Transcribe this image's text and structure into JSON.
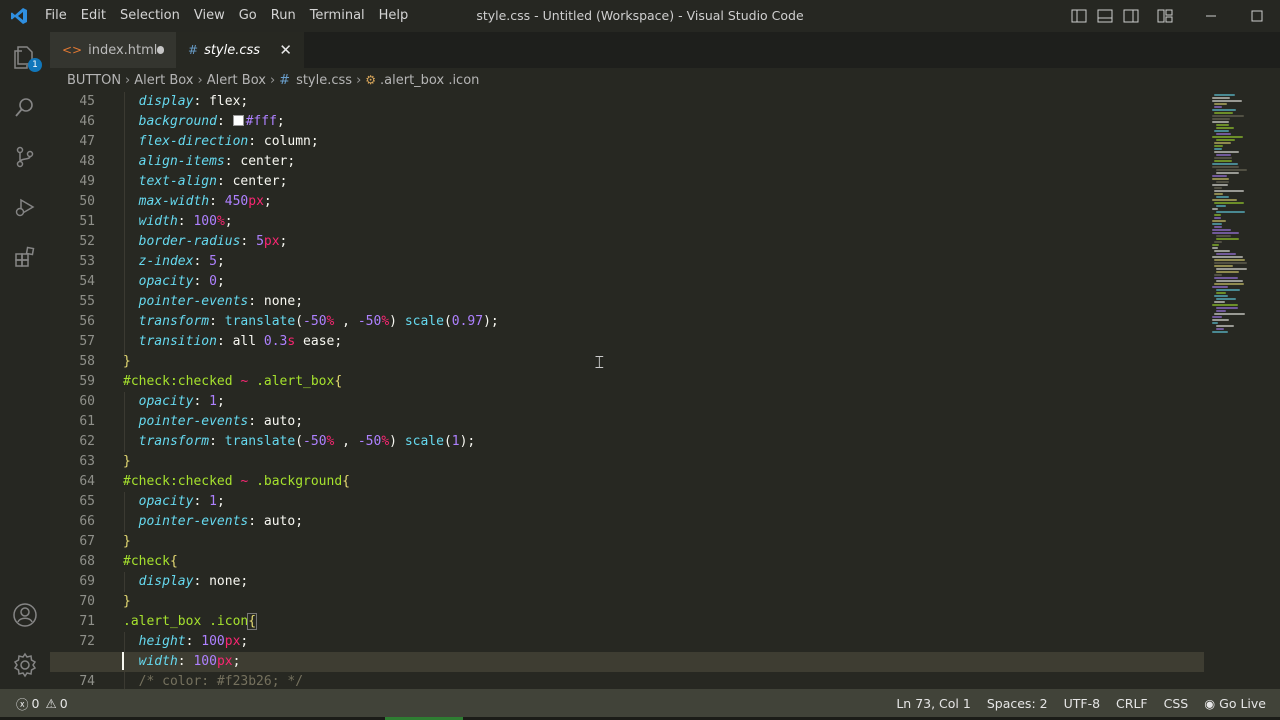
{
  "menu": [
    "File",
    "Edit",
    "Selection",
    "View",
    "Go",
    "Run",
    "Terminal",
    "Help"
  ],
  "window_title": "style.css - Untitled (Workspace) - Visual Studio Code",
  "activity": {
    "explorer_badge": "1"
  },
  "tabs": [
    {
      "label": "index.html",
      "icon": "<>",
      "state": "modified"
    },
    {
      "label": "style.css",
      "icon": "#",
      "state": "active"
    }
  ],
  "breadcrumb": {
    "items": [
      "BUTTON",
      "Alert Box",
      "Alert Box"
    ],
    "file": "style.css",
    "symbol": ".alert_box .icon"
  },
  "editor": {
    "line_numbers": [
      "45",
      "46",
      "47",
      "48",
      "49",
      "50",
      "51",
      "52",
      "53",
      "54",
      "55",
      "56",
      "57",
      "58",
      "59",
      "60",
      "61",
      "62",
      "63",
      "64",
      "65",
      "66",
      "67",
      "68",
      "69",
      "70",
      "71",
      "72",
      "73",
      "74"
    ],
    "current_line": "73"
  },
  "status": {
    "errors": "0",
    "warnings": "0",
    "position": "Ln 73, Col 1",
    "spaces": "Spaces: 2",
    "encoding": "UTF-8",
    "eol": "CRLF",
    "language": "CSS",
    "live": "Go Live"
  },
  "colors": {
    "background": "#272822",
    "status_bar": "#414339",
    "property": "#66d9ef",
    "number": "#ae81ff",
    "selector": "#a6e22e"
  }
}
